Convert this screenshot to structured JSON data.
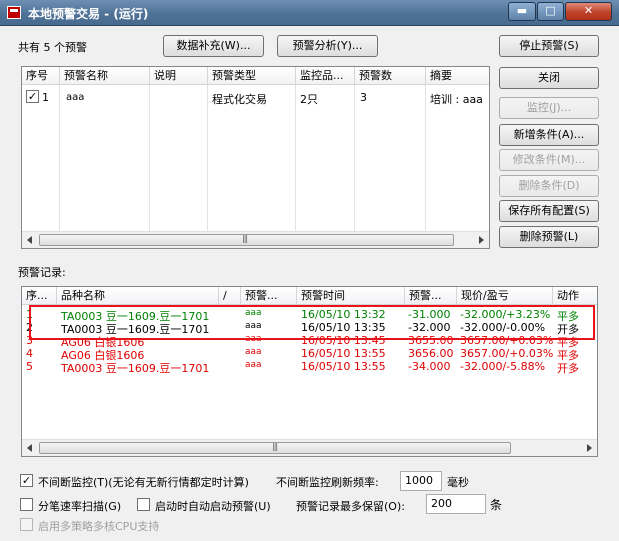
{
  "window": {
    "title": "本地预警交易 - (运行)",
    "min_glyph": "▬",
    "max_glyph": "□",
    "close_glyph": "✕"
  },
  "top": {
    "count_label": "共有 5 个预警",
    "data_supplement_btn": "数据补充(W)...",
    "alert_analysis_btn": "预警分析(Y)..."
  },
  "right_buttons": {
    "stop": "停止预警(S)",
    "close": "关闭",
    "monitor": "监控(J)...",
    "add_condition": "新增条件(A)...",
    "modify_condition": "修改条件(M)...",
    "delete_condition": "删除条件(D)",
    "save_all": "保存所有配置(S)",
    "delete_alert": "删除预警(L)"
  },
  "alerts_table": {
    "headers": [
      "序号",
      "预警名称",
      "说明",
      "预警类型",
      "监控品...",
      "预警数",
      "摘要"
    ],
    "rows": [
      {
        "checked": "✓",
        "no": "1",
        "name": "aaa",
        "desc": "",
        "type": "程式化交易",
        "monitor": "2只",
        "count": "3",
        "summary": "培训 : aaa"
      }
    ]
  },
  "records_label": "预警记录:",
  "records_table": {
    "headers": [
      "序...",
      "品种名称",
      "/",
      "预警...",
      "预警时间",
      "预警...",
      "现价/盈亏",
      "动作"
    ],
    "rows": [
      {
        "no": "1",
        "name": "TA0003 豆一1609.豆一1701",
        "alert": "aaa",
        "time": "16/05/10 13:32",
        "price": "-31.000",
        "pnl": "-32.000/+3.23%",
        "action": "平多",
        "color": "green"
      },
      {
        "no": "2",
        "name": "TA0003 豆一1609.豆一1701",
        "alert": "aaa",
        "time": "16/05/10 13:35",
        "price": "-32.000",
        "pnl": "-32.000/-0.00%",
        "action": "开多",
        "color": "blk"
      },
      {
        "no": "3",
        "name": "AG06 白银1606",
        "alert": "aaa",
        "time": "16/05/10 13:45",
        "price": "3655.00",
        "pnl": "3657.00/+0.03%",
        "action": "平多",
        "color": "red"
      },
      {
        "no": "4",
        "name": "AG06 白银1606",
        "alert": "aaa",
        "time": "16/05/10 13:55",
        "price": "3656.00",
        "pnl": "3657.00/+0.03%",
        "action": "平多",
        "color": "red"
      },
      {
        "no": "5",
        "name": "TA0003 豆一1609.豆一1701",
        "alert": "aaa",
        "time": "16/05/10 13:55",
        "price": "-34.000",
        "pnl": "-32.000/-5.88%",
        "action": "开多",
        "color": "red"
      }
    ]
  },
  "bottom": {
    "continuous_monitor": "不间断监控(T)(无论有无新行情都定时计算)",
    "continuous_checked": "✓",
    "refresh_rate_label": "不间断监控刷新频率:",
    "refresh_rate_value": "1000",
    "ms_unit": "毫秒",
    "tick_scan": "分笔速率扫描(G)",
    "auto_start": "启动时自动启动预警(U)",
    "max_records_label": "预警记录最多保留(O):",
    "max_records_value": "200",
    "records_unit": "条",
    "multi_core": "启用多策略多核CPU支持"
  },
  "colors": {
    "highlight_box": "#e8131b",
    "green_text": "#008000",
    "red_text": "#e00000"
  }
}
